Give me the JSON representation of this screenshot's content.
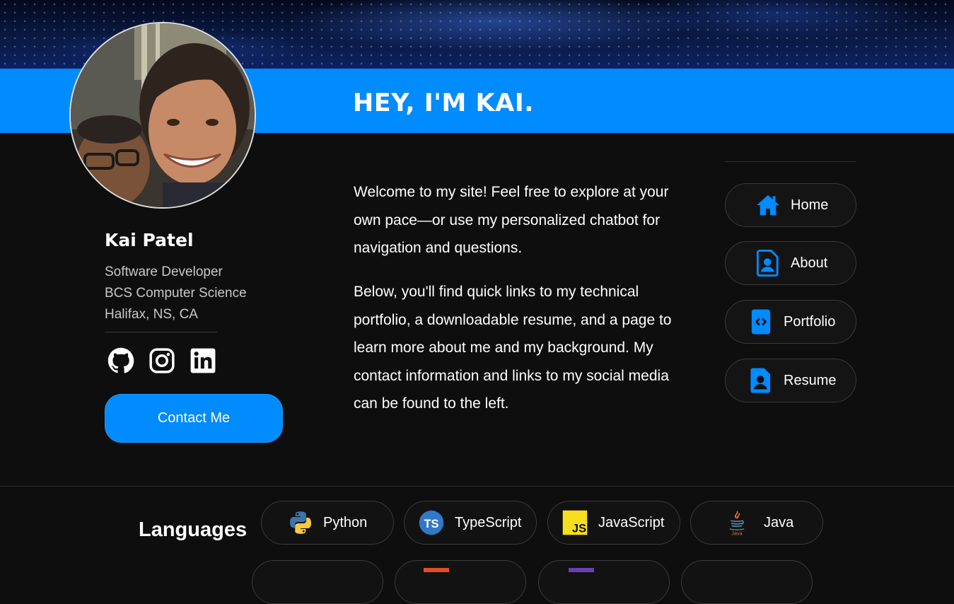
{
  "banner": {
    "title": "HEY, I'M KAI."
  },
  "profile": {
    "name": "Kai Patel",
    "role": "Software Developer",
    "degree": "BCS Computer Science",
    "location": "Halifax, NS, CA",
    "contact_label": "Contact Me",
    "socials": [
      {
        "icon": "github-icon"
      },
      {
        "icon": "instagram-icon"
      },
      {
        "icon": "linkedin-icon"
      }
    ]
  },
  "intro": {
    "paragraph1": "Welcome to my site! Feel free to explore at your own pace—or use my personalized chatbot for navigation and questions.",
    "paragraph2": "Below, you'll find quick links to my technical portfolio, a downloadable resume, and a page to learn more about me and my background. My contact information and links to my social media can be found to the left."
  },
  "nav": [
    {
      "label": "Home",
      "icon": "home-icon"
    },
    {
      "label": "About",
      "icon": "profile-card-icon"
    },
    {
      "label": "Portfolio",
      "icon": "code-file-icon"
    },
    {
      "label": "Resume",
      "icon": "resume-file-icon"
    }
  ],
  "languages": {
    "title": "Languages",
    "items": [
      {
        "label": "Python",
        "icon": "python-icon"
      },
      {
        "label": "TypeScript",
        "icon": "typescript-icon"
      },
      {
        "label": "JavaScript",
        "icon": "javascript-icon"
      },
      {
        "label": "Java",
        "icon": "java-icon"
      }
    ]
  },
  "colors": {
    "accent": "#008bff",
    "background": "#0e0e0e",
    "chip_border": "#3a3a3a"
  }
}
